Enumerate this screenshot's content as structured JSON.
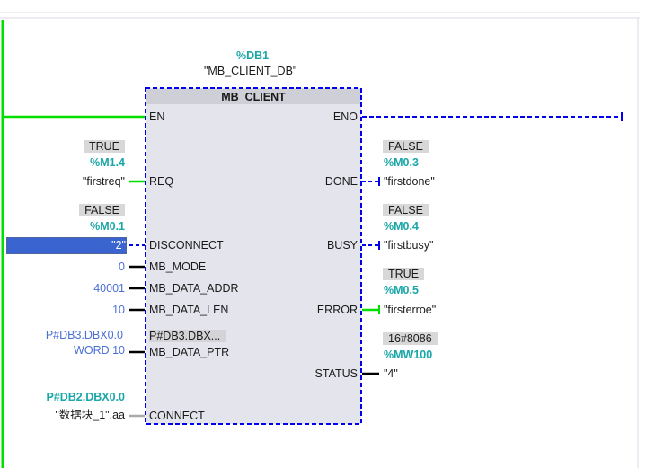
{
  "instance": {
    "db_address": "%DB1",
    "db_name": "\"MB_CLIENT_DB\""
  },
  "block": {
    "title": "MB_CLIENT"
  },
  "inputs": {
    "en": {
      "pin": "EN"
    },
    "req": {
      "pin": "REQ",
      "value": "TRUE",
      "address": "%M1.4",
      "tag": "\"firstreq\""
    },
    "disconnect": {
      "pin": "DISCONNECT",
      "value": "FALSE",
      "address": "%M0.1",
      "tag": "\"2\""
    },
    "mb_mode": {
      "pin": "MB_MODE",
      "tag": "0"
    },
    "mb_data_addr": {
      "pin": "MB_DATA_ADDR",
      "tag": "40001"
    },
    "mb_data_len": {
      "pin": "MB_DATA_LEN",
      "tag": "10"
    },
    "mb_data_ptr": {
      "pin": "MB_DATA_PTR",
      "tag_line1": "P#DB3.DBX0.0",
      "tag_line2": "WORD 10",
      "value": "P#DB3.DBX..."
    },
    "connect": {
      "pin": "CONNECT",
      "address": "P#DB2.DBX0.0",
      "tag": "\"数据块_1\".aa"
    }
  },
  "outputs": {
    "eno": {
      "pin": "ENO"
    },
    "done": {
      "pin": "DONE",
      "value": "FALSE",
      "address": "%M0.3",
      "tag": "\"firstdone\""
    },
    "busy": {
      "pin": "BUSY",
      "value": "FALSE",
      "address": "%M0.4",
      "tag": "\"firstbusy\""
    },
    "error": {
      "pin": "ERROR",
      "value": "TRUE",
      "address": "%M0.5",
      "tag": "\"firsterroe\""
    },
    "status": {
      "pin": "STATUS",
      "value": "16#8086",
      "address": "%MW100",
      "tag": "\"4\""
    }
  },
  "colors": {
    "power_flow": "#00e000",
    "no_flow": "#0000ee",
    "address": "#1aa7a7",
    "constant": "#4a6fd6",
    "selection": "#3a64d0"
  }
}
